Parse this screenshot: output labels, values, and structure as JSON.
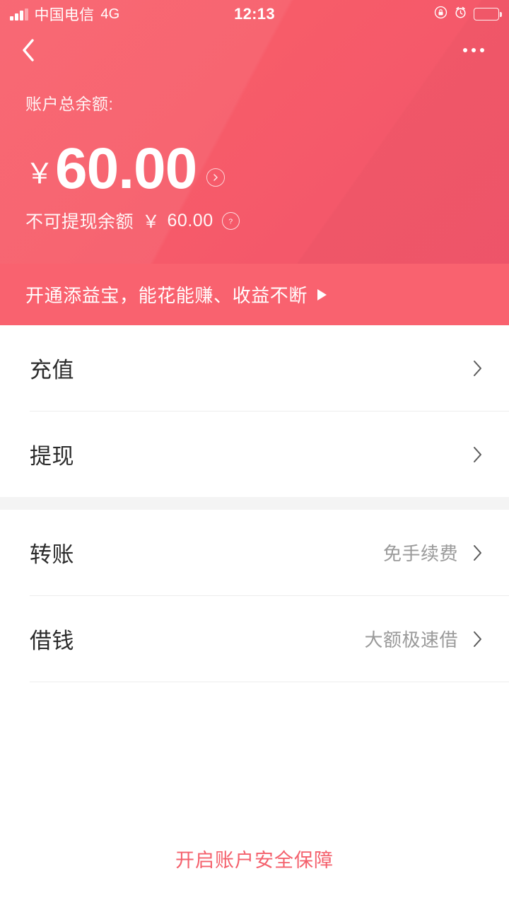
{
  "status_bar": {
    "carrier": "中国电信",
    "network": "4G",
    "time": "12:13",
    "icons": [
      "signal-bars-icon",
      "rotation-lock-icon",
      "alarm-clock-icon",
      "battery-icon"
    ]
  },
  "nav": {
    "back_icon": "chevron-left-icon",
    "more_icon": "more-dots-icon"
  },
  "balance": {
    "label": "账户总余额:",
    "currency_symbol": "￥",
    "amount": "60.00",
    "detail_icon": "chevron-right-circle-icon",
    "sub_label": "不可提现余额",
    "sub_currency_symbol": "￥",
    "sub_amount": "60.00",
    "help_icon": "question-circle-icon"
  },
  "promo": {
    "text": "开通添益宝，能花能赚、收益不断",
    "arrow_icon": "play-triangle-icon",
    "background_color": "#f9626f"
  },
  "menu_groups": [
    {
      "rows": [
        {
          "label": "充值",
          "value": "",
          "chevron_icon": "chevron-right-icon"
        },
        {
          "label": "提现",
          "value": "",
          "chevron_icon": "chevron-right-icon"
        }
      ]
    },
    {
      "rows": [
        {
          "label": "转账",
          "value": "免手续费",
          "chevron_icon": "chevron-right-icon"
        },
        {
          "label": "借钱",
          "value": "大额极速借",
          "chevron_icon": "chevron-right-icon"
        }
      ]
    }
  ],
  "footer": {
    "link_text": "开启账户安全保障",
    "link_color": "#f4606c"
  },
  "theme": {
    "header_red": "#f75c69",
    "promo_red": "#f9626f",
    "divider_gray": "#ededed",
    "gap_gray": "#f4f4f4",
    "label_dark": "#2b2b2b",
    "value_gray": "#9a9a9a"
  }
}
